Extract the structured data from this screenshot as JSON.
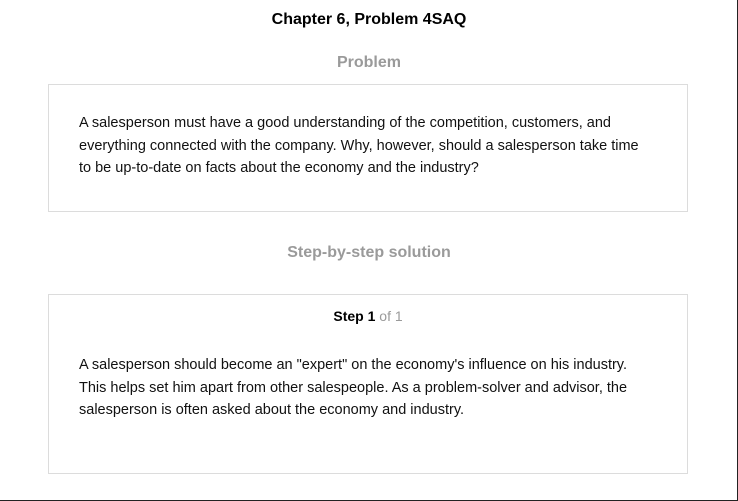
{
  "chapter_title": "Chapter 6, Problem 4SAQ",
  "problem": {
    "heading": "Problem",
    "text": "A salesperson must have a good understanding of the competition, customers, and everything connected with the company. Why, however, should a salesperson take time to be up-to-date on facts about the economy and the industry?"
  },
  "solution": {
    "heading": "Step-by-step solution",
    "step": {
      "word": "Step",
      "number": "1",
      "of_text": "of 1"
    },
    "text": "A salesperson should become an \"expert\" on the economy's influence on his industry. This helps set him apart from other salespeople. As a problem-solver and advisor, the salesperson is often asked about the economy and industry."
  }
}
